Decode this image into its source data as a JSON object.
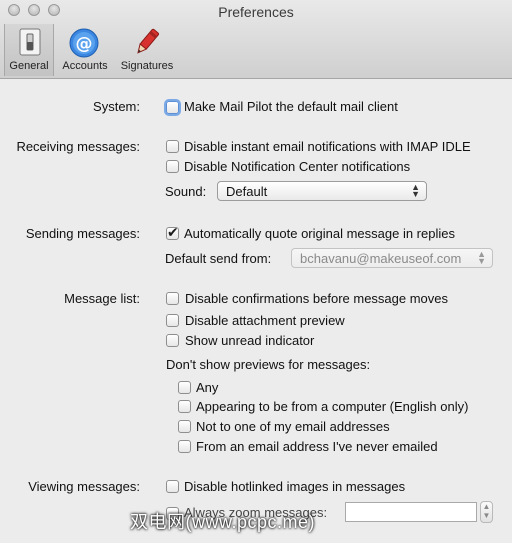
{
  "window": {
    "title": "Preferences"
  },
  "toolbar": {
    "tabs": [
      {
        "label": "General",
        "icon": "switch-icon"
      },
      {
        "label": "Accounts",
        "icon": "at-icon"
      },
      {
        "label": "Signatures",
        "icon": "pen-icon"
      }
    ],
    "selected": "General"
  },
  "system": {
    "label": "System:",
    "default_client": {
      "label": "Make Mail Pilot the default mail client",
      "checked": false
    }
  },
  "receiving": {
    "label": "Receiving messages:",
    "options": [
      {
        "label": "Disable instant email notifications with IMAP IDLE",
        "checked": false
      },
      {
        "label": "Disable Notification Center notifications",
        "checked": false
      }
    ],
    "sound_label": "Sound:",
    "sound_value": "Default"
  },
  "sending": {
    "label": "Sending messages:",
    "quote": {
      "label": "Automatically quote original message in replies",
      "checked": true
    },
    "send_from_label": "Default send from:",
    "send_from_value": "bchavanu@makeuseof.com"
  },
  "message_list": {
    "label": "Message list:",
    "options": [
      {
        "label": "Disable confirmations before message moves",
        "checked": false
      },
      {
        "label": "Disable attachment preview",
        "checked": false
      },
      {
        "label": "Show unread indicator",
        "checked": false
      }
    ],
    "previews_heading": "Don't show previews for messages:",
    "preview_options": [
      {
        "label": "Any",
        "checked": false
      },
      {
        "label": "Appearing to be from a computer (English only)",
        "checked": false
      },
      {
        "label": "Not to one of my email addresses",
        "checked": false
      },
      {
        "label": "From an email address I've never emailed",
        "checked": false
      }
    ]
  },
  "viewing": {
    "label": "Viewing messages:",
    "hotlinked": {
      "label": "Disable hotlinked images in messages",
      "checked": false
    },
    "zoom_label": "Always zoom messages:",
    "zoom_value": ""
  },
  "watermark": "双电网(www.pcpc.me)",
  "colors": {
    "focus_ring": "#7aa9e6",
    "accounts_icon": "#2f7ed8",
    "signatures_icon": "#d12f2f"
  }
}
